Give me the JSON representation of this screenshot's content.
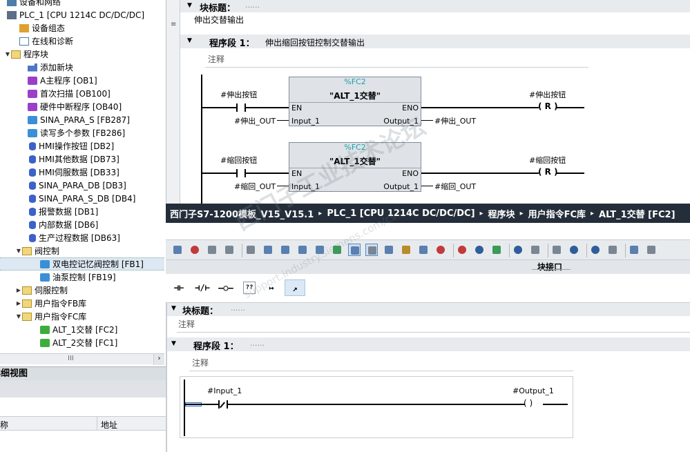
{
  "tree": {
    "items": [
      {
        "label": "设备和网络",
        "icon": "devices-networks-icon",
        "expand": ""
      },
      {
        "label": "PLC_1 [CPU 1214C DC/DC/DC]",
        "icon": "plc-icon",
        "expand": ""
      },
      {
        "label": "设备组态",
        "icon": "device-config-icon",
        "expand": ""
      },
      {
        "label": "在线和诊断",
        "icon": "online-diagnostics-icon",
        "expand": ""
      },
      {
        "label": "程序块",
        "icon": "folder-icon",
        "expand": "▼"
      },
      {
        "label": "添加新块",
        "icon": "add-block-icon",
        "expand": ""
      },
      {
        "label": "A主程序 [OB1]",
        "icon": "ob-block-icon",
        "expand": ""
      },
      {
        "label": "首次扫描 [OB100]",
        "icon": "ob-block-icon",
        "expand": ""
      },
      {
        "label": "硬件中断程序 [OB40]",
        "icon": "ob-block-icon",
        "expand": ""
      },
      {
        "label": "SINA_PARA_S [FB287]",
        "icon": "fb-block-icon",
        "expand": ""
      },
      {
        "label": "读写多个参数 [FB286]",
        "icon": "fb-block-icon",
        "expand": ""
      },
      {
        "label": "HMI操作按钮 [DB2]",
        "icon": "db-block-icon",
        "expand": ""
      },
      {
        "label": "HMI其他数据 [DB73]",
        "icon": "db-block-icon",
        "expand": ""
      },
      {
        "label": "HMI伺服数据 [DB33]",
        "icon": "db-block-icon",
        "expand": ""
      },
      {
        "label": "SINA_PARA_DB [DB3]",
        "icon": "db-block-icon",
        "expand": ""
      },
      {
        "label": "SINA_PARA_S_DB [DB4]",
        "icon": "db-block-icon",
        "expand": ""
      },
      {
        "label": "报警数据 [DB1]",
        "icon": "db-block-icon",
        "expand": ""
      },
      {
        "label": "内部数据 [DB6]",
        "icon": "db-block-icon",
        "expand": ""
      },
      {
        "label": "生产过程数据 [DB63]",
        "icon": "db-block-icon",
        "expand": ""
      },
      {
        "label": "阀控制",
        "icon": "folder-icon",
        "expand": "▼"
      },
      {
        "label": "双电控记忆阀控制 [FB1]",
        "icon": "fb-block-icon",
        "expand": ""
      },
      {
        "label": "油泵控制 [FB19]",
        "icon": "fb-block-icon",
        "expand": ""
      },
      {
        "label": "伺服控制",
        "icon": "folder-icon",
        "expand": "▶"
      },
      {
        "label": "用户指令FB库",
        "icon": "folder-icon",
        "expand": "▶"
      },
      {
        "label": "用户指令FC库",
        "icon": "folder-icon",
        "expand": "▼"
      },
      {
        "label": "ALT_1交替 [FC2]",
        "icon": "fc-block-icon",
        "expand": ""
      },
      {
        "label": "ALT_2交替 [FC1]",
        "icon": "fc-block-icon",
        "expand": ""
      }
    ],
    "scroll_glyph": "III",
    "scroll_right": "›"
  },
  "details": {
    "title": "详细视图",
    "col_name": "名称",
    "col_address": "地址"
  },
  "back_editor": {
    "block_title_label": "块标题：",
    "block_title_dots": "......",
    "block_title_text": "伸出交替输出",
    "segment_label": "程序段 1：",
    "segment_text": "伸出缩回按钮控制交替输出",
    "segment_comment": "注释",
    "rung1": {
      "contact_op": "#伸出按钮",
      "fc_tag": "%FC2",
      "fc_name": "\"ALT_1交替\"",
      "en": "EN",
      "eno": "ENO",
      "input_pin": "Input_1",
      "output_pin": "Output_1",
      "input_op": "#伸出_OUT",
      "output_op": "#伸出_OUT",
      "coil_op": "#伸出按钮",
      "coil": "( R )"
    },
    "rung2": {
      "contact_op": "#缩回按钮",
      "fc_tag": "%FC2",
      "fc_name": "\"ALT_1交替\"",
      "en": "EN",
      "eno": "ENO",
      "input_pin": "Input_1",
      "output_pin": "Output_1",
      "input_op": "#缩回_OUT",
      "output_op": "#缩回_OUT",
      "coil_op": "#缩回按钮",
      "coil": "( R )"
    }
  },
  "front_window": {
    "breadcrumb": [
      "西门子S7-1200模板_V15_V15.1",
      "PLC_1 [CPU 1214C DC/DC/DC]",
      "程序块",
      "用户指令FC库",
      "ALT_1交替 [FC2]"
    ],
    "breadcrumb_sep": "▸",
    "interface_label": "块接口",
    "palette": [
      "⊣⊢",
      "⊣/⊢",
      "–○–",
      "??",
      "↦",
      "↗"
    ],
    "block_title_label": "块标题：",
    "block_title_dots": "......",
    "block_title_comment": "注释",
    "segment_label": "程序段 1：",
    "segment_dots": "......",
    "segment_comment": "注释",
    "rung": {
      "contact_op": "#Input_1",
      "coil_op": "#Output_1",
      "coil": "(   )"
    }
  },
  "watermark": {
    "main": "西门子工业技术论坛",
    "url": "support.industry.siemens.com/cs"
  }
}
